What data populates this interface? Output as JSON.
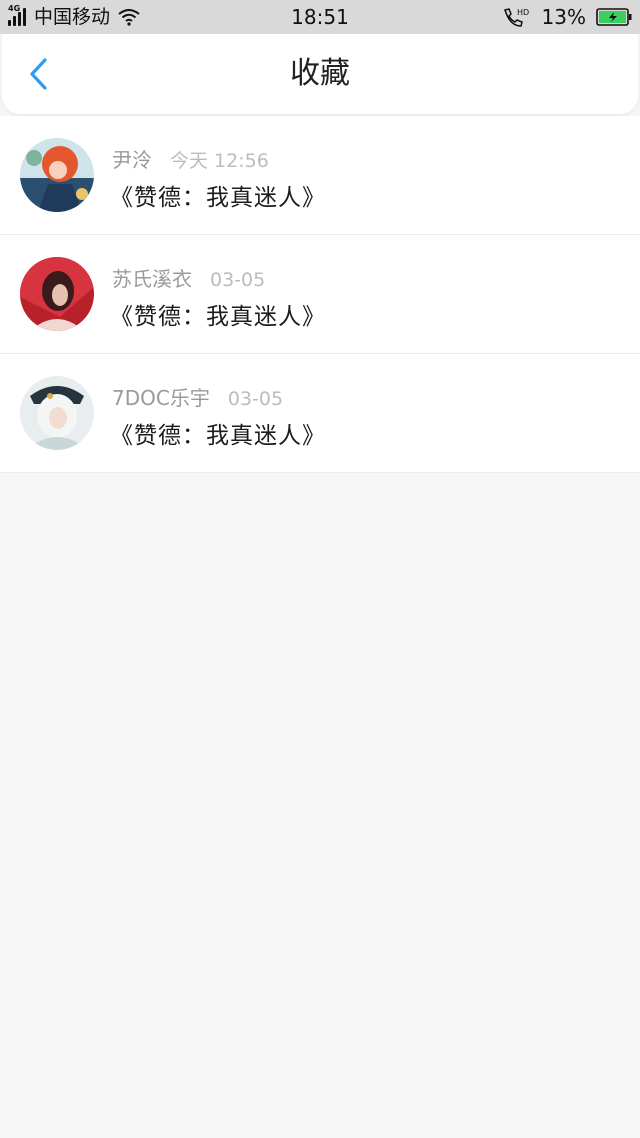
{
  "statusbar": {
    "network_tag": "4G",
    "carrier": "中国移动",
    "time": "18:51",
    "battery_percent": "13%",
    "icons": [
      "signal-icon",
      "wifi-icon",
      "hd-call-icon",
      "battery-charging-icon"
    ]
  },
  "header": {
    "title": "收藏",
    "back_icon": "chevron-left-icon",
    "accent_color": "#2a9df4"
  },
  "favorites": [
    {
      "name": "尹泠",
      "time": "今天 12:56",
      "content": "《赞德：我真迷人》",
      "avatar": "avatar-red-haired-character"
    },
    {
      "name": "苏氏溪衣",
      "time": "03-05",
      "content": "《赞德：我真迷人》",
      "avatar": "avatar-red-dark-portrait"
    },
    {
      "name": "7DOC乐宇",
      "time": "03-05",
      "content": "《赞德：我真迷人》",
      "avatar": "avatar-white-haired-character"
    }
  ]
}
